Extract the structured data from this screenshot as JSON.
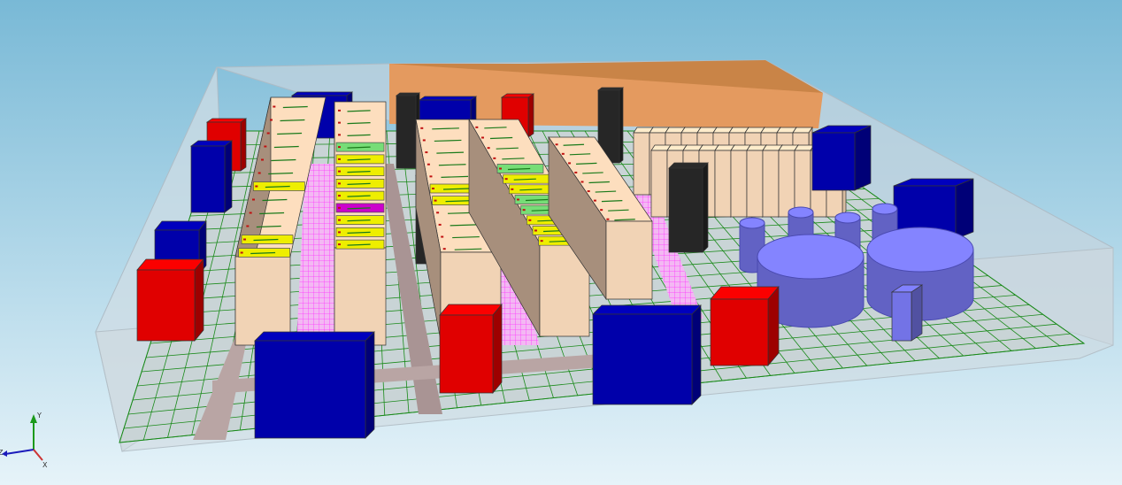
{
  "colors": {
    "crac_red": "#e00000",
    "pdu_blue": "#0000aa",
    "rack_beige": "#f1d3b5",
    "rack_side": "#a78f7c",
    "rack_yellow": "#eeee00",
    "rack_green": "#77dd77",
    "rack_magenta": "#cc00cc",
    "column_black": "#262626",
    "wall_orange": "#e39b60",
    "chiller_lavender": "#7373e6",
    "perforated_tile_magenta": "#ff66ff",
    "grid_green": "#1a8a1a",
    "room_glass": "#c8d6df"
  },
  "axes": {
    "y": "Y",
    "z": "Z",
    "x": "X"
  }
}
